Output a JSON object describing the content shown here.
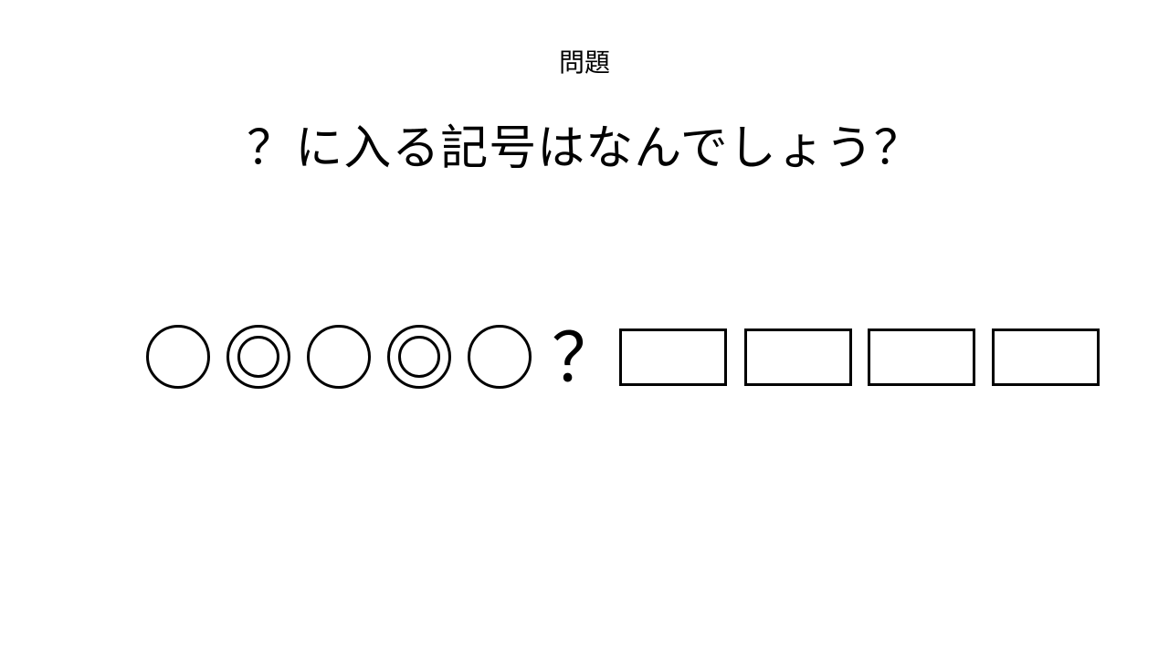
{
  "slide": {
    "heading": "問題",
    "question": "？に入る記号はなんでしょう？"
  },
  "sequence": {
    "items": [
      {
        "symbol": "circle-icon"
      },
      {
        "symbol": "double-circle-icon"
      },
      {
        "symbol": "circle-icon"
      },
      {
        "symbol": "double-circle-icon"
      },
      {
        "symbol": "circle-icon"
      },
      {
        "symbol": "question-mark",
        "text": "？"
      },
      {
        "symbol": "rectangle-icon"
      },
      {
        "symbol": "rectangle-icon"
      },
      {
        "symbol": "rectangle-icon"
      },
      {
        "symbol": "rectangle-icon"
      }
    ]
  }
}
